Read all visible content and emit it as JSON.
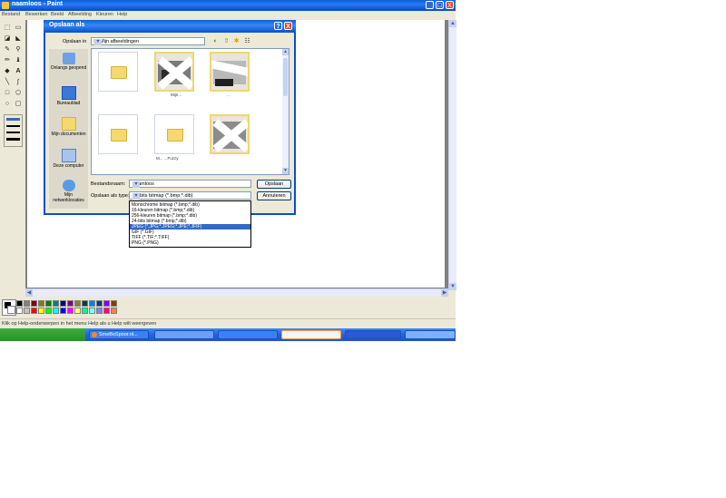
{
  "window": {
    "title": "naamloos - Paint",
    "controls": [
      "_",
      "□",
      "X"
    ]
  },
  "menu": [
    "Bestand",
    "Bewerken",
    "Beeld",
    "Afbeelding",
    "Kleuren",
    "Help"
  ],
  "status_text": "Klik op Help-onderwerpen in het menu Help als u Help wilt weergeven",
  "taskbar": {
    "task_label": "SmeBoSpoor.nl..."
  },
  "colors": {
    "xp_blue": "#0a5fd8",
    "selection": "#316ac5",
    "window_bg": "#ece9d8"
  },
  "palette": {
    "row1": [
      "#000000",
      "#808080",
      "#800000",
      "#808000",
      "#008000",
      "#008080",
      "#000080",
      "#800080",
      "#808040",
      "#004040",
      "#0080ff",
      "#004080",
      "#8000ff",
      "#804000"
    ],
    "row2": [
      "#ffffff",
      "#c0c0c0",
      "#ff0000",
      "#ffff00",
      "#00ff00",
      "#00ffff",
      "#0000ff",
      "#ff00ff",
      "#ffff80",
      "#00ff80",
      "#80ffff",
      "#8080ff",
      "#ff0080",
      "#ff8040"
    ]
  },
  "dialog": {
    "title": "Opslaan als",
    "save_in_label": "Opslaan in",
    "save_in_value": "Mijn afbeeldingen",
    "places": [
      {
        "label": "Onlangs geopend",
        "icon": "recent-documents-icon"
      },
      {
        "label": "Bureaublad",
        "icon": "desktop-icon"
      },
      {
        "label": "Mijn documenten",
        "icon": "my-documents-icon"
      },
      {
        "label": "Deze computer",
        "icon": "my-computer-icon"
      },
      {
        "label": "Mijn netwerklocaties",
        "icon": "network-places-icon"
      }
    ],
    "filename_label": "Bestandsnaam:",
    "filename_value": "naamloos",
    "filetype_label": "Opslaan als type:",
    "filetype_value": "24-bits bitmap (*.bmp;*.dib)",
    "save_button": "Opslaan",
    "cancel_button": "Annuleren",
    "filetype_options": [
      "Monochrome bitmap (*.bmp;*.dib)",
      "16-kleuren bitmap (*.bmp;*.dib)",
      "256-kleuren bitmap (*.bmp;*.dib)",
      "24-bits bitmap (*.bmp;*.dib)",
      "JPEG (*.JPG;*.JPEG;*.JPE;*.JFIF)",
      "GIF (*.GIF)",
      "TIFF (*.TIF;*.TIFF)",
      "PNG (*.PNG)"
    ],
    "selected_option_index": 4,
    "file_items": [
      {
        "kind": "folder",
        "name": ""
      },
      {
        "kind": "image",
        "name": "Mijn..."
      },
      {
        "kind": "image",
        "name": "..."
      },
      {
        "kind": "folder",
        "name": ""
      },
      {
        "kind": "folder",
        "name": "M...  ...Fuzzy"
      },
      {
        "kind": "image",
        "name": ""
      }
    ]
  }
}
